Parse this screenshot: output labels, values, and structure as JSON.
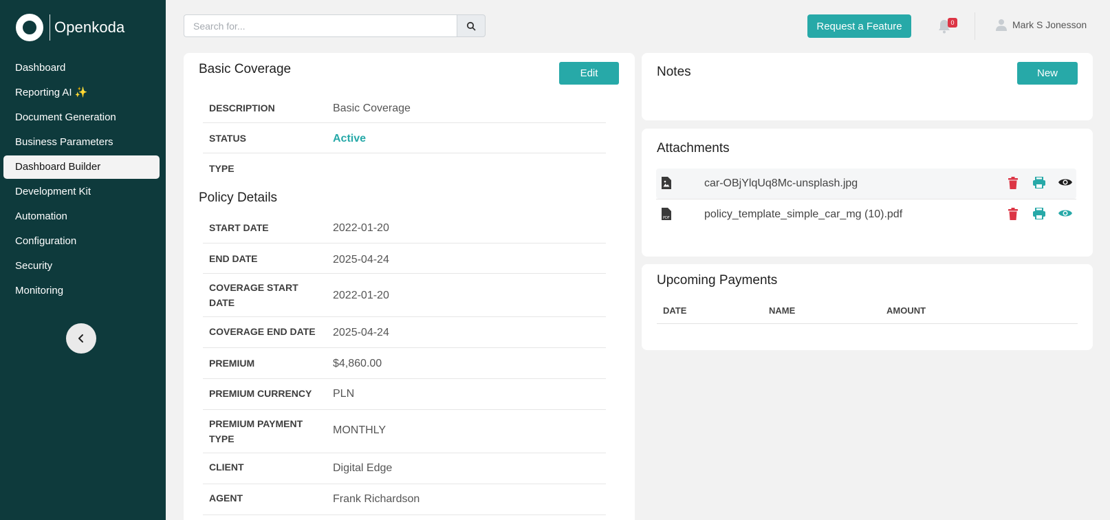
{
  "brand": {
    "name": "Openkoda"
  },
  "sidebar": {
    "items": [
      {
        "label": "Dashboard"
      },
      {
        "label": "Reporting AI ✨"
      },
      {
        "label": "Document Generation"
      },
      {
        "label": "Business Parameters"
      },
      {
        "label": "Dashboard Builder",
        "active": true
      },
      {
        "label": "Development Kit"
      },
      {
        "label": "Automation"
      },
      {
        "label": "Configuration"
      },
      {
        "label": "Security"
      },
      {
        "label": "Monitoring"
      }
    ],
    "collapse_icon": "chevron-left-icon"
  },
  "topbar": {
    "search_placeholder": "Search for...",
    "search_icon": "search-icon",
    "request_feature_label": "Request a Feature",
    "notification_count": "0",
    "user_name": "Mark S Jonesson"
  },
  "coverage": {
    "title": "Basic Coverage",
    "edit_label": "Edit",
    "fields": [
      {
        "label": "DESCRIPTION",
        "value": "Basic Coverage"
      },
      {
        "label": "STATUS",
        "value": "Active"
      },
      {
        "label": "TYPE",
        "value": ""
      }
    ],
    "policy_title": "Policy Details",
    "policy_fields": [
      {
        "label": "START DATE",
        "value": "2022-01-20"
      },
      {
        "label": "END DATE",
        "value": "2025-04-24"
      },
      {
        "label": "COVERAGE START DATE",
        "value": "2022-01-20"
      },
      {
        "label": "COVERAGE END DATE",
        "value": "2025-04-24"
      },
      {
        "label": "PREMIUM",
        "value": "$4,860.00"
      },
      {
        "label": "PREMIUM CURRENCY",
        "value": "PLN"
      },
      {
        "label": "PREMIUM PAYMENT TYPE",
        "value": "MONTHLY"
      },
      {
        "label": "CLIENT",
        "value": "Digital Edge"
      },
      {
        "label": "AGENT",
        "value": "Frank Richardson"
      }
    ]
  },
  "notes": {
    "title": "Notes",
    "new_label": "New"
  },
  "attachments": {
    "title": "Attachments",
    "files": [
      {
        "name": "car-OBjYlqUq8Mc-unsplash.jpg",
        "icon": "image-file-icon"
      },
      {
        "name": "policy_template_simple_car_mg (10).pdf",
        "icon": "pdf-file-icon"
      }
    ]
  },
  "payments": {
    "title": "Upcoming Payments",
    "columns": [
      "DATE",
      "NAME",
      "AMOUNT"
    ]
  },
  "colors": {
    "sidebar": "#0e3a3c",
    "accent": "#27a9a8",
    "danger": "#dc3545"
  }
}
